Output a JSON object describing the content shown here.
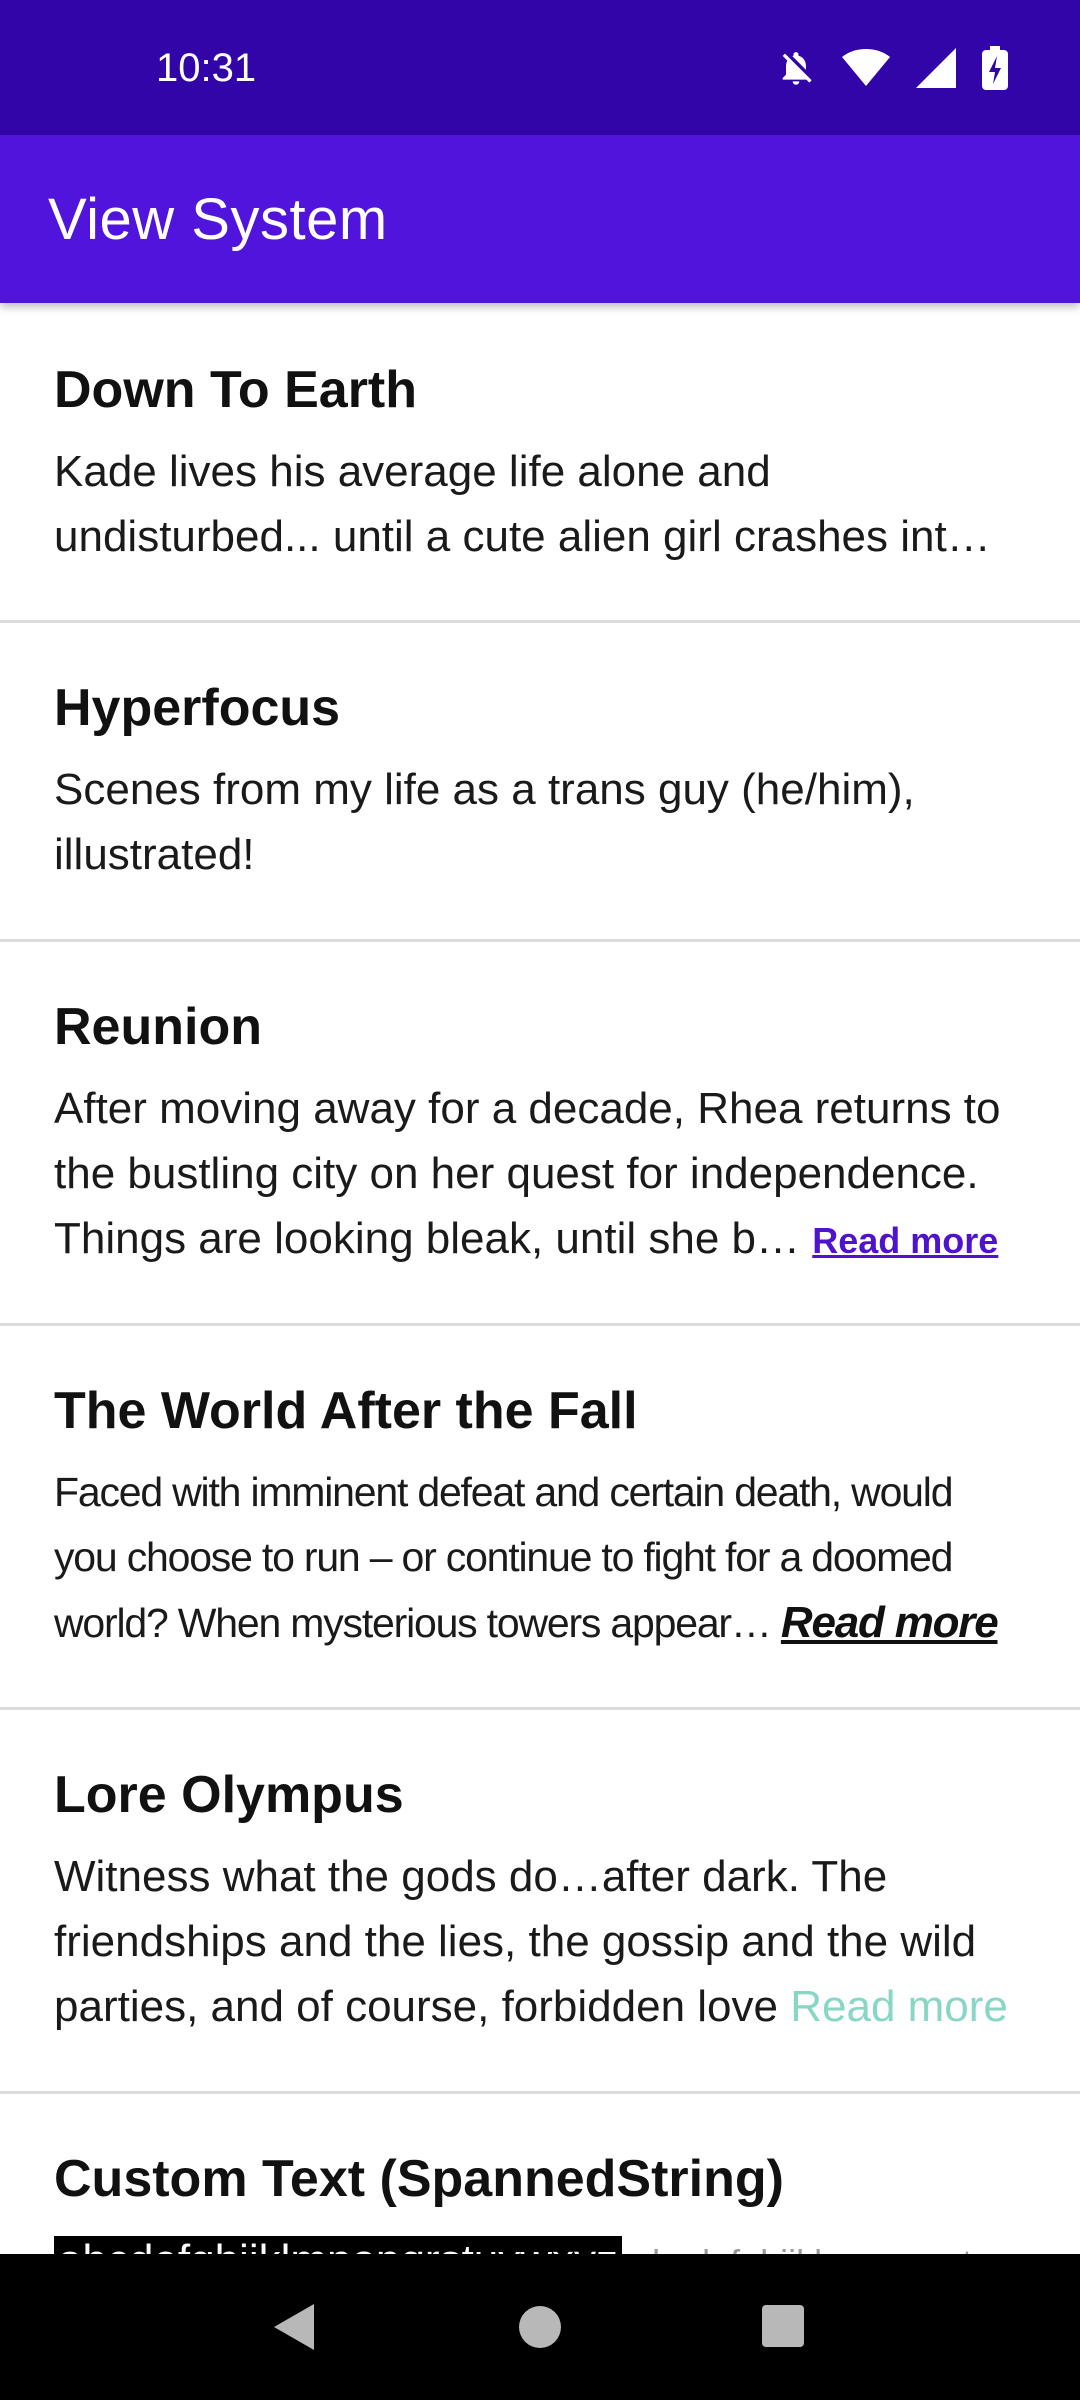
{
  "status_bar": {
    "time": "10:31",
    "icons": [
      "notifications-off-icon",
      "wifi-icon",
      "signal-icon",
      "battery-charging-icon"
    ]
  },
  "app_bar": {
    "title": "View System",
    "color": "#5014dc"
  },
  "items": [
    {
      "title": "Down To Earth",
      "desc_lines": [
        "Kade lives his average life alone and",
        "undisturbed... until a cute alien girl crashes int…"
      ],
      "read_more": ""
    },
    {
      "title": "Hyperfocus",
      "desc_lines": [
        "Scenes from my life as a trans guy (he/him),",
        "illustrated!"
      ],
      "read_more": ""
    },
    {
      "title": "Reunion",
      "desc_lines": [
        "After moving away for a decade, Rhea returns to",
        "the bustling city on her quest for independence.",
        "Things are looking bleak, until she b… "
      ],
      "read_more": "Read more"
    },
    {
      "title": "The World After the Fall",
      "desc_lines": [
        "Faced with imminent defeat and certain death, would",
        "you choose to run – or continue to fight for a doomed",
        "world? When mysterious towers appear… "
      ],
      "read_more": "Read more"
    },
    {
      "title": "Lore Olympus",
      "desc_lines": [
        "Witness what the gods do…after dark. The",
        "friendships and the lies, the gossip and the wild",
        "parties, and of course, forbidden love "
      ],
      "read_more": "Read more"
    },
    {
      "title": "Custom Text (SpannedString)",
      "desc_highlight": "abcdefghijklmnopqrstuvwxyz",
      "desc_rest": " abcdefghijklmnopqrst"
    }
  ],
  "nav_bar": {
    "back": "back-icon",
    "home": "home-icon",
    "recents": "recents-icon"
  }
}
